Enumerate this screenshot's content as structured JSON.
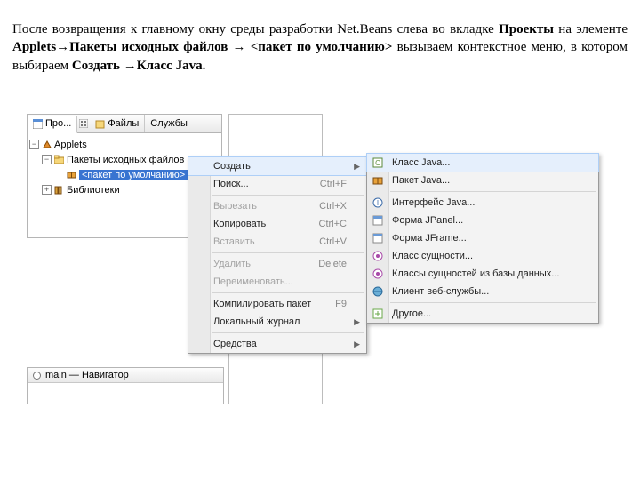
{
  "instruction": {
    "t1": "После возвращения к главному окну среды разработки Net.Beans слева во вкладке ",
    "b1": "Проекты",
    "t2": " на элементе ",
    "b2": "Applets→Пакеты исходных файлов → <пакет по умолчанию>",
    "t3": " вызываем контекстное меню, в котором выбираем ",
    "b3": "Создать →Класс Java.",
    "t4": ""
  },
  "tabs": {
    "t1": "Про...",
    "t2": "Файлы",
    "t3": "Службы"
  },
  "tree": {
    "root": "Applets",
    "pkgsrc": "Пакеты исходных файлов",
    "defpkg": "<пакет по умолчанию>",
    "libs": "Библиотеки"
  },
  "navigator": {
    "title": "main — Навигатор"
  },
  "ctx_main": [
    {
      "k": "create",
      "label": "Создать",
      "sub": true,
      "hl": true
    },
    {
      "k": "find",
      "label": "Поиск...",
      "kb": "Ctrl+F"
    },
    {
      "sep": true
    },
    {
      "k": "cut",
      "label": "Вырезать",
      "kb": "Ctrl+X",
      "dis": true
    },
    {
      "k": "copy",
      "label": "Копировать",
      "kb": "Ctrl+C"
    },
    {
      "k": "paste",
      "label": "Вставить",
      "kb": "Ctrl+V",
      "dis": true
    },
    {
      "sep": true
    },
    {
      "k": "delete",
      "label": "Удалить",
      "kb": "Delete",
      "dis": true
    },
    {
      "k": "rename",
      "label": "Переименовать...",
      "dis": true
    },
    {
      "sep": true
    },
    {
      "k": "compile",
      "label": "Компилировать пакет",
      "kb": "F9"
    },
    {
      "k": "journal",
      "label": "Локальный журнал",
      "sub": true
    },
    {
      "sep": true
    },
    {
      "k": "tools",
      "label": "Средства",
      "sub": true
    }
  ],
  "ctx_sub": [
    {
      "k": "jclass",
      "label": "Класс Java...",
      "ic": "cls",
      "hl": true
    },
    {
      "k": "jpkg",
      "label": "Пакет Java...",
      "ic": "pkg"
    },
    {
      "sep": true
    },
    {
      "k": "jintf",
      "label": "Интерфейс Java...",
      "ic": "intf"
    },
    {
      "k": "jpanel",
      "label": "Форма JPanel...",
      "ic": "frm"
    },
    {
      "k": "jframe",
      "label": "Форма JFrame...",
      "ic": "frm"
    },
    {
      "k": "entity",
      "label": "Класс сущности...",
      "ic": "ent"
    },
    {
      "k": "entdb",
      "label": "Классы сущностей из базы данных...",
      "ic": "ent"
    },
    {
      "k": "wsclient",
      "label": "Клиент веб-службы...",
      "ic": "ws"
    },
    {
      "sep": true
    },
    {
      "k": "other",
      "label": "Другое...",
      "ic": "oth"
    }
  ]
}
